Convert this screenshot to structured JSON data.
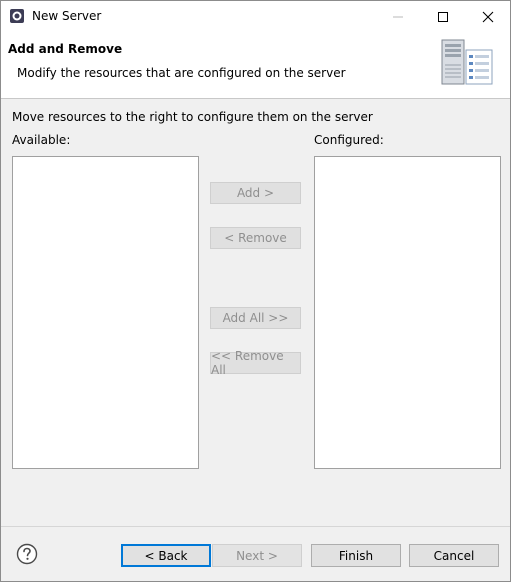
{
  "window": {
    "title": "New Server"
  },
  "header": {
    "title": "Add and Remove",
    "description": "Modify the resources that are configured on the server"
  },
  "main": {
    "instructions": "Move resources to the right to configure them on the server",
    "available_label": "Available:",
    "configured_label": "Configured:",
    "available_items": [],
    "configured_items": []
  },
  "actions": {
    "add": "Add >",
    "remove": "< Remove",
    "add_all": "Add All >>",
    "remove_all": "<< Remove All"
  },
  "footer": {
    "back": "< Back",
    "next": "Next >",
    "finish": "Finish",
    "cancel": "Cancel"
  },
  "icons": {
    "app": "eclipse-icon",
    "header": "server-icon",
    "help": "help-icon",
    "minimize": "minimize-icon",
    "maximize": "maximize-icon",
    "close": "close-icon"
  },
  "colors": {
    "default_button_border": "#0078d7",
    "disabled_text": "#8f8f8f"
  }
}
